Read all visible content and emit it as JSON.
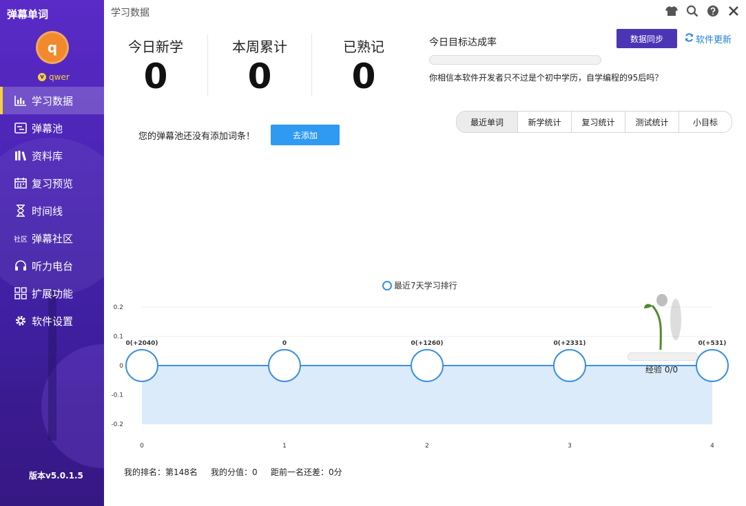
{
  "app": {
    "title": "弹幕单词"
  },
  "user": {
    "avatar_letter": "q",
    "name": "qwer",
    "vip_badge": "v"
  },
  "nav": {
    "items": [
      {
        "label": "学习数据",
        "icon": "bar-chart-icon",
        "active": true
      },
      {
        "label": "弹幕池",
        "icon": "danmaku-icon",
        "active": false
      },
      {
        "label": "资料库",
        "icon": "books-icon",
        "active": false
      },
      {
        "label": "复习预览",
        "icon": "calendar-icon",
        "active": false
      },
      {
        "label": "时间线",
        "icon": "hourglass-icon",
        "active": false
      },
      {
        "label": "弹幕社区",
        "icon": "community-icon",
        "icon_text": "社区",
        "active": false
      },
      {
        "label": "听力电台",
        "icon": "headphones-icon",
        "active": false
      },
      {
        "label": "扩展功能",
        "icon": "grid-icon",
        "active": false
      },
      {
        "label": "软件设置",
        "icon": "gear-icon",
        "active": false
      }
    ]
  },
  "version": "版本v5.0.1.5",
  "page_title": "学习数据",
  "window_icons": [
    "shirt-icon",
    "search-icon",
    "help-icon",
    "close-icon"
  ],
  "stats": [
    {
      "label": "今日新学",
      "value": "0"
    },
    {
      "label": "本周累计",
      "value": "0"
    },
    {
      "label": "已熟记",
      "value": "0"
    }
  ],
  "goal": {
    "label": "今日目标达成率",
    "progress": 0,
    "note": "你相信本软件开发者只不过是个初中学历，自学编程的95后吗？"
  },
  "sync_button": "数据同步",
  "update_link": "软件更新",
  "tabs": [
    "最近单词",
    "新学统计",
    "复习统计",
    "测试统计",
    "小目标"
  ],
  "active_tab": 0,
  "empty_message": "您的弹幕池还没有添加词条！",
  "add_button": "去添加",
  "experience": {
    "label": "经验 0/0",
    "progress": 0
  },
  "chart_data": {
    "type": "line",
    "legend": "最近7天学习排行",
    "legend_position": "top-center",
    "x": [
      0,
      1,
      2,
      3,
      4
    ],
    "x_tick_labels": [
      "0",
      "1",
      "2",
      "3",
      "4"
    ],
    "y_ticks": [
      "0.2",
      "0.1",
      "0",
      "-0.1",
      "-0.2"
    ],
    "ylim": [
      -0.2,
      0.2
    ],
    "series": [
      {
        "name": "最近7天学习排行",
        "values": [
          0,
          0,
          0,
          0,
          0
        ],
        "data_labels": [
          "0(+2040)",
          "0",
          "0(+1260)",
          "0(+2331)",
          "0(+531)"
        ]
      }
    ],
    "line_color": "#3a8fe0",
    "area_color": "#dcebf9",
    "grid": true
  },
  "ranking": {
    "rank_text": "我的排名：第148名",
    "score_text": "我的分值：0",
    "gap_text": "距前一名还差：0分"
  }
}
